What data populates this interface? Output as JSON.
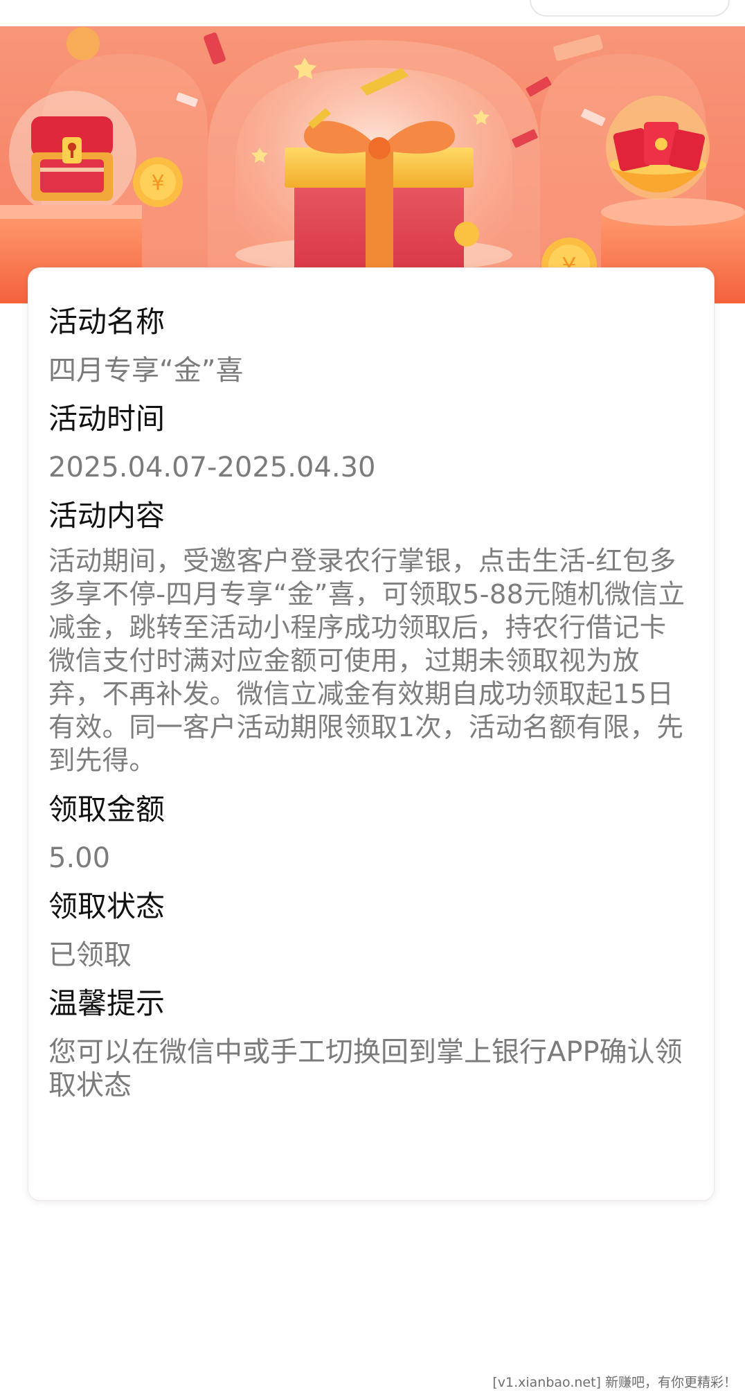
{
  "activity": {
    "name_label": "活动名称",
    "name_value": "四月专享“金”喜",
    "time_label": "活动时间",
    "time_value": "2025.04.07-2025.04.30",
    "content_label": "活动内容",
    "content_value": "活动期间，受邀客户登录农行掌银，点击生活-红包多多享不停-四月专享“金”喜，可领取5-88元随机微信立减金，跳转至活动小程序成功领取后，持农行借记卡微信支付时满对应金额可使用，过期未领取视为放弃，不再补发。微信立减金有效期自成功领取起15日有效。同一客户活动期限领取1次，活动名额有限，先到先得。",
    "amount_label": "领取金额",
    "amount_value": "5.00",
    "status_label": "领取状态",
    "status_value": "已领取",
    "tip_label": "温馨提示",
    "tip_value": "您可以在微信中或手工切换回到掌上银行APP确认领取状态"
  },
  "watermark": "[v1.xianbao.net] 新赚吧，有你更精彩！",
  "colors": {
    "banner_primary": "#f6876a",
    "banner_light": "#fbd2bf",
    "gift_red": "#e34452",
    "gift_gold": "#f6c243",
    "heading_text": "#111111",
    "value_text": "#7b7b7b"
  },
  "icons": [
    "treasure-chest-icon",
    "gift-box-icon",
    "red-envelope-bowl-icon",
    "gold-coin-icon"
  ]
}
